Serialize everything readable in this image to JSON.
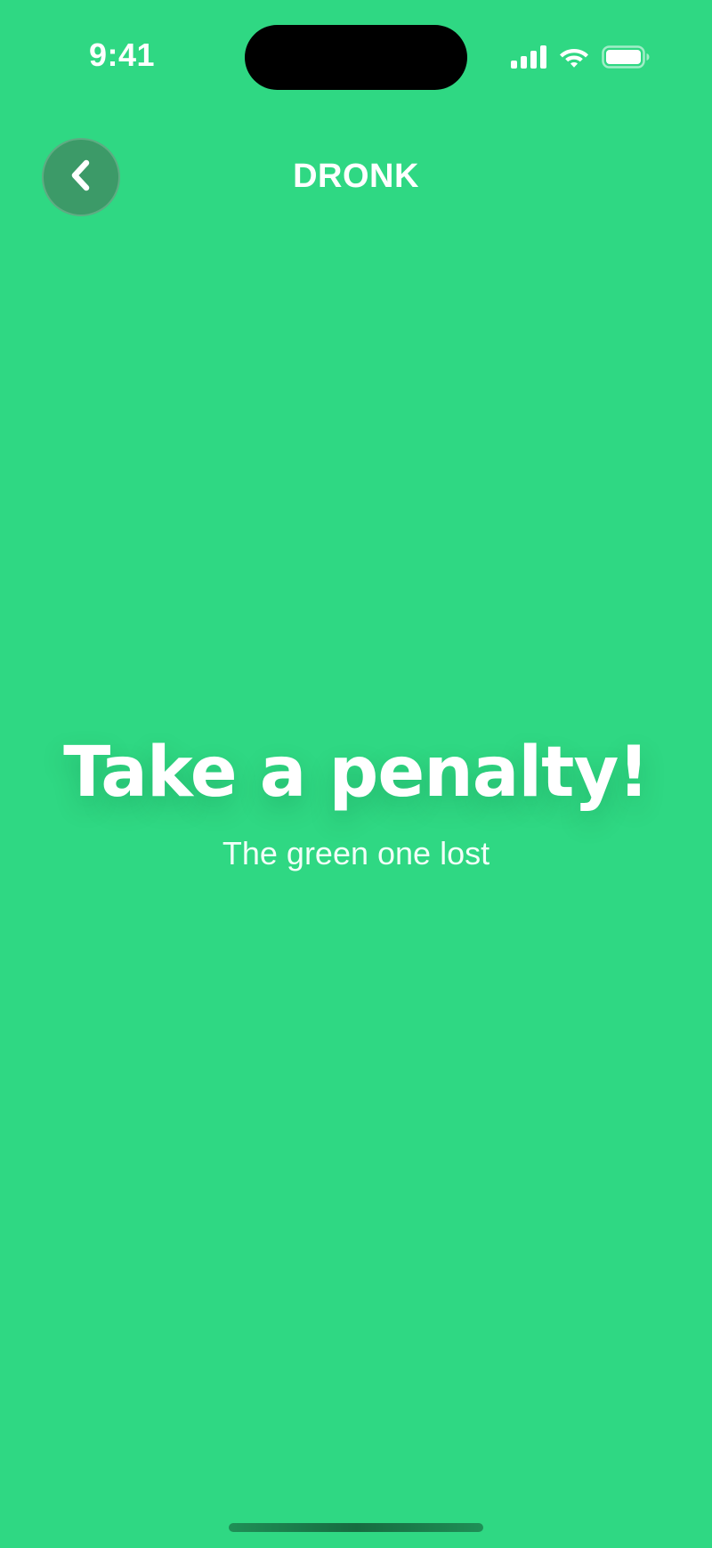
{
  "status_bar": {
    "time": "9:41",
    "icons": [
      "cellular-signal-icon",
      "wifi-icon",
      "battery-icon"
    ]
  },
  "nav": {
    "back_icon": "chevron-left-icon",
    "title": "DRONK"
  },
  "content": {
    "headline": "Take a penalty!",
    "subtitle": "The green one lost"
  },
  "colors": {
    "background": "#2fd883",
    "back_button": "#3c9a68",
    "text": "#ffffff"
  }
}
